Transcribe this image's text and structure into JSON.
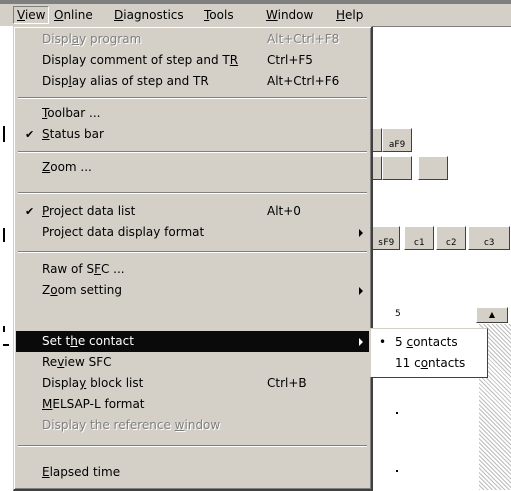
{
  "menubar": {
    "items": [
      {
        "label_pre": "",
        "label_u": "V",
        "label_post": "iew"
      },
      {
        "label_pre": "",
        "label_u": "O",
        "label_post": "nline"
      },
      {
        "label_pre": "",
        "label_u": "D",
        "label_post": "iagnostics"
      },
      {
        "label_pre": "",
        "label_u": "T",
        "label_post": "ools"
      },
      {
        "label_pre": "",
        "label_u": "W",
        "label_post": "indow"
      },
      {
        "label_pre": "",
        "label_u": "H",
        "label_post": "elp"
      }
    ]
  },
  "view_menu": {
    "display_program": {
      "pre": "Displ",
      "u": "a",
      "post": "y program",
      "shortcut": "Alt+Ctrl+F8"
    },
    "display_comment": {
      "pre": "Display comment of step and T",
      "u": "R",
      "post": "",
      "shortcut": "Ctrl+F5"
    },
    "display_alias": {
      "pre": "Disp",
      "u": "l",
      "post": "ay alias of step and TR",
      "shortcut": "Alt+Ctrl+F6"
    },
    "toolbar": {
      "pre": "",
      "u": "T",
      "post": "oolbar ..."
    },
    "status_bar": {
      "pre": "",
      "u": "S",
      "post": "tatus bar",
      "check": "✔"
    },
    "zoom": {
      "pre": "",
      "u": "Z",
      "post": "oom ..."
    },
    "project_data_list": {
      "pre": "",
      "u": "P",
      "post": "roject data list",
      "shortcut": "Alt+0",
      "check": "✔"
    },
    "project_data_display_format": {
      "pre": "Pro",
      "u": "j",
      "post": "ect data display format"
    },
    "raw_of_sfc": {
      "pre": "Raw of S",
      "u": "F",
      "post": "C ..."
    },
    "zoom_setting": {
      "pre": "Z",
      "u": "o",
      "post": "om setting"
    },
    "set_the_contact": {
      "pre": "Set t",
      "u": "h",
      "post": "e contact"
    },
    "review_sfc": {
      "pre": "Re",
      "u": "v",
      "post": "iew SFC"
    },
    "display_block_list": {
      "pre": "Displa",
      "u": "y",
      "post": " block list",
      "shortcut": "Ctrl+B"
    },
    "melsap_l_format": {
      "pre": "",
      "u": "M",
      "post": "ELSAP-L format"
    },
    "display_reference_window": {
      "pre": "Display the reference ",
      "u": "w",
      "post": "indow"
    },
    "elapsed_time": {
      "pre": "",
      "u": "E",
      "post": "lapsed time"
    }
  },
  "contact_submenu": {
    "five": {
      "bullet": "•",
      "pre": "5 ",
      "u": "c",
      "post": "ontacts"
    },
    "eleven": {
      "pre": "11 c",
      "u": "o",
      "post": "ntacts"
    }
  },
  "background": {
    "toolbar_labels": {
      "af9": "aF9",
      "sf9": "sF9",
      "c1": "c1",
      "c2": "c2",
      "c3": "c3"
    },
    "column_number": "5"
  },
  "colors": {
    "menu_bg": "#d4d0c8",
    "highlight_bg": "#0a0a0a",
    "disabled_text": "#808080"
  }
}
